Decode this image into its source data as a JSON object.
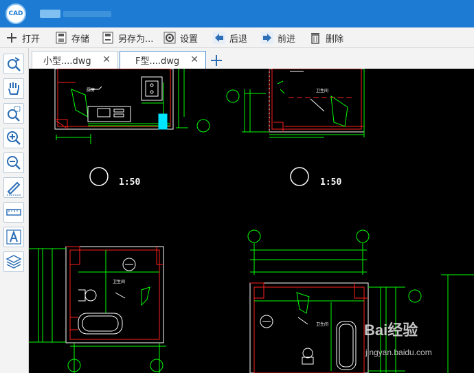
{
  "app": {
    "logo_text": "CAD"
  },
  "toolbar": {
    "items": [
      {
        "label": "打开",
        "icon": "plus-icon"
      },
      {
        "label": "存储",
        "icon": "save-icon"
      },
      {
        "label": "另存为...",
        "icon": "save-as-icon"
      },
      {
        "label": "设置",
        "icon": "gear-icon"
      },
      {
        "label": "后退",
        "icon": "undo-arrow-icon"
      },
      {
        "label": "前进",
        "icon": "redo-arrow-icon"
      },
      {
        "label": "删除",
        "icon": "trash-icon"
      }
    ]
  },
  "sidebar": {
    "tools": [
      "refresh-view-icon",
      "pan-hand-icon",
      "zoom-window-icon",
      "zoom-in-icon",
      "zoom-out-icon",
      "annotate-pen-icon",
      "measure-ruler-icon",
      "text-icon",
      "layers-icon"
    ]
  },
  "tabs": [
    {
      "label": "小型....dwg",
      "active": false
    },
    {
      "label": "F型....dwg",
      "active": true
    }
  ],
  "drawing": {
    "scale_labels": [
      "1:50",
      "1:50"
    ],
    "room_labels": [
      "厨房",
      "卫生间",
      "卫生间",
      "卫生间"
    ]
  },
  "watermark": {
    "brand": "Bai经验",
    "url": "jingyan.baidu.com"
  },
  "colors": {
    "titlebar": "#1e7bd3",
    "canvas": "#000000",
    "cad_green": "#00ff00",
    "cad_red": "#ff2020",
    "cad_cyan": "#00e5ff"
  }
}
